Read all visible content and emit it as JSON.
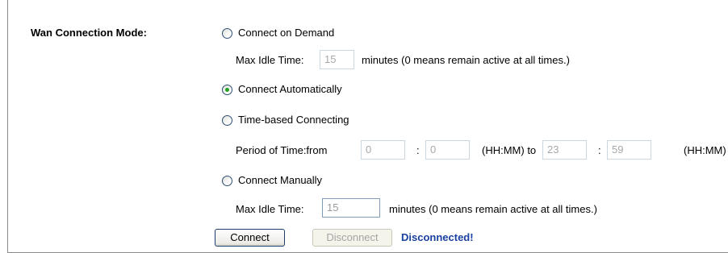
{
  "wan": {
    "mode_label": "Wan Connection Mode:",
    "options": {
      "demand": {
        "label": "Connect on Demand",
        "selected": false
      },
      "auto": {
        "label": "Connect Automatically",
        "selected": true
      },
      "time": {
        "label": "Time-based Connecting",
        "selected": false
      },
      "manual": {
        "label": "Connect Manually",
        "selected": false
      }
    },
    "demand_idle": {
      "label": "Max Idle Time:",
      "value": "15",
      "hint": "minutes (0 means remain active at all times.)"
    },
    "time_period": {
      "label": "Period of Time:from",
      "from_hh": "0",
      "colon1": ":",
      "from_mm": "0",
      "to_label": "(HH:MM) to",
      "to_hh": "23",
      "colon2": ":",
      "to_mm": "59",
      "tail": "(HH:MM)"
    },
    "manual_idle": {
      "label": "Max Idle Time:",
      "value": "15",
      "hint": "minutes (0 means remain active at all times.)"
    },
    "buttons": {
      "connect": "Connect",
      "disconnect": "Disconnect"
    },
    "status_text": "Disconnected!",
    "colors": {
      "status": "#1a40a0",
      "radio_selected": "#21a121",
      "field_border": "#7f9db9"
    }
  }
}
